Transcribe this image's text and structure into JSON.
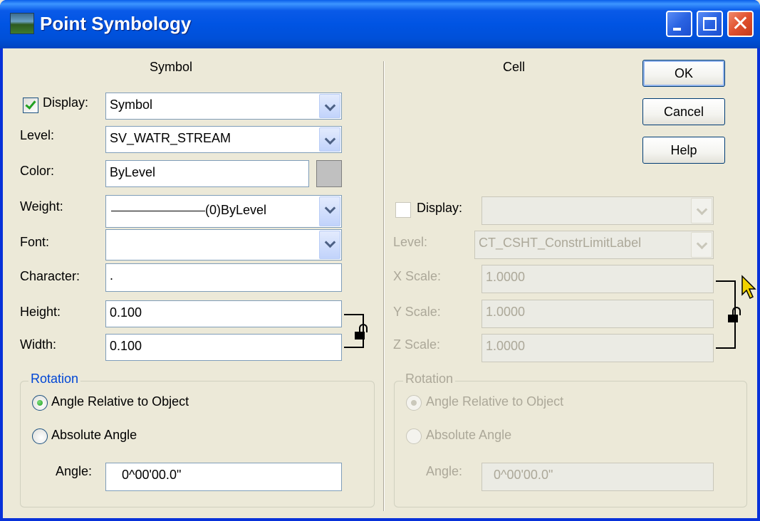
{
  "window": {
    "title": "Point Symbology"
  },
  "buttons": {
    "ok": "OK",
    "cancel": "Cancel",
    "help": "Help"
  },
  "symbol": {
    "header": "Symbol",
    "display_label": "Display:",
    "display_checked": true,
    "display_value": "Symbol",
    "level_label": "Level:",
    "level_value": "SV_WATR_STREAM",
    "color_label": "Color:",
    "color_value": "ByLevel",
    "color_swatch": "#C0C0C0",
    "weight_label": "Weight:",
    "weight_value": "(0)ByLevel",
    "font_label": "Font:",
    "font_value": "",
    "character_label": "Character:",
    "character_value": ".",
    "height_label": "Height:",
    "height_value": "0.100",
    "width_label": "Width:",
    "width_value": "0.100",
    "rotation": {
      "legend": "Rotation",
      "option_relative": "Angle Relative to Object",
      "option_absolute": "Absolute Angle",
      "selected": "relative",
      "angle_label": "Angle:",
      "angle_value": "0^00'00.0\""
    }
  },
  "cell": {
    "header": "Cell",
    "display_label": "Display:",
    "display_checked": false,
    "display_value": "",
    "level_label": "Level:",
    "level_value": "CT_CSHT_ConstrLimitLabel",
    "xscale_label": "X Scale:",
    "xscale_value": "1.0000",
    "yscale_label": "Y Scale:",
    "yscale_value": "1.0000",
    "zscale_label": "Z Scale:",
    "zscale_value": "1.0000",
    "rotation": {
      "legend": "Rotation",
      "option_relative": "Angle Relative to Object",
      "option_absolute": "Absolute Angle",
      "selected": "relative",
      "angle_label": "Angle:",
      "angle_value": "0^00'00.0\""
    }
  },
  "colors": {
    "titlebar": "#0054E3",
    "dialog_bg": "#ECE9D8",
    "group_legend": "#0046D5",
    "disabled_text": "#ACA899",
    "check_green": "#21A121"
  }
}
